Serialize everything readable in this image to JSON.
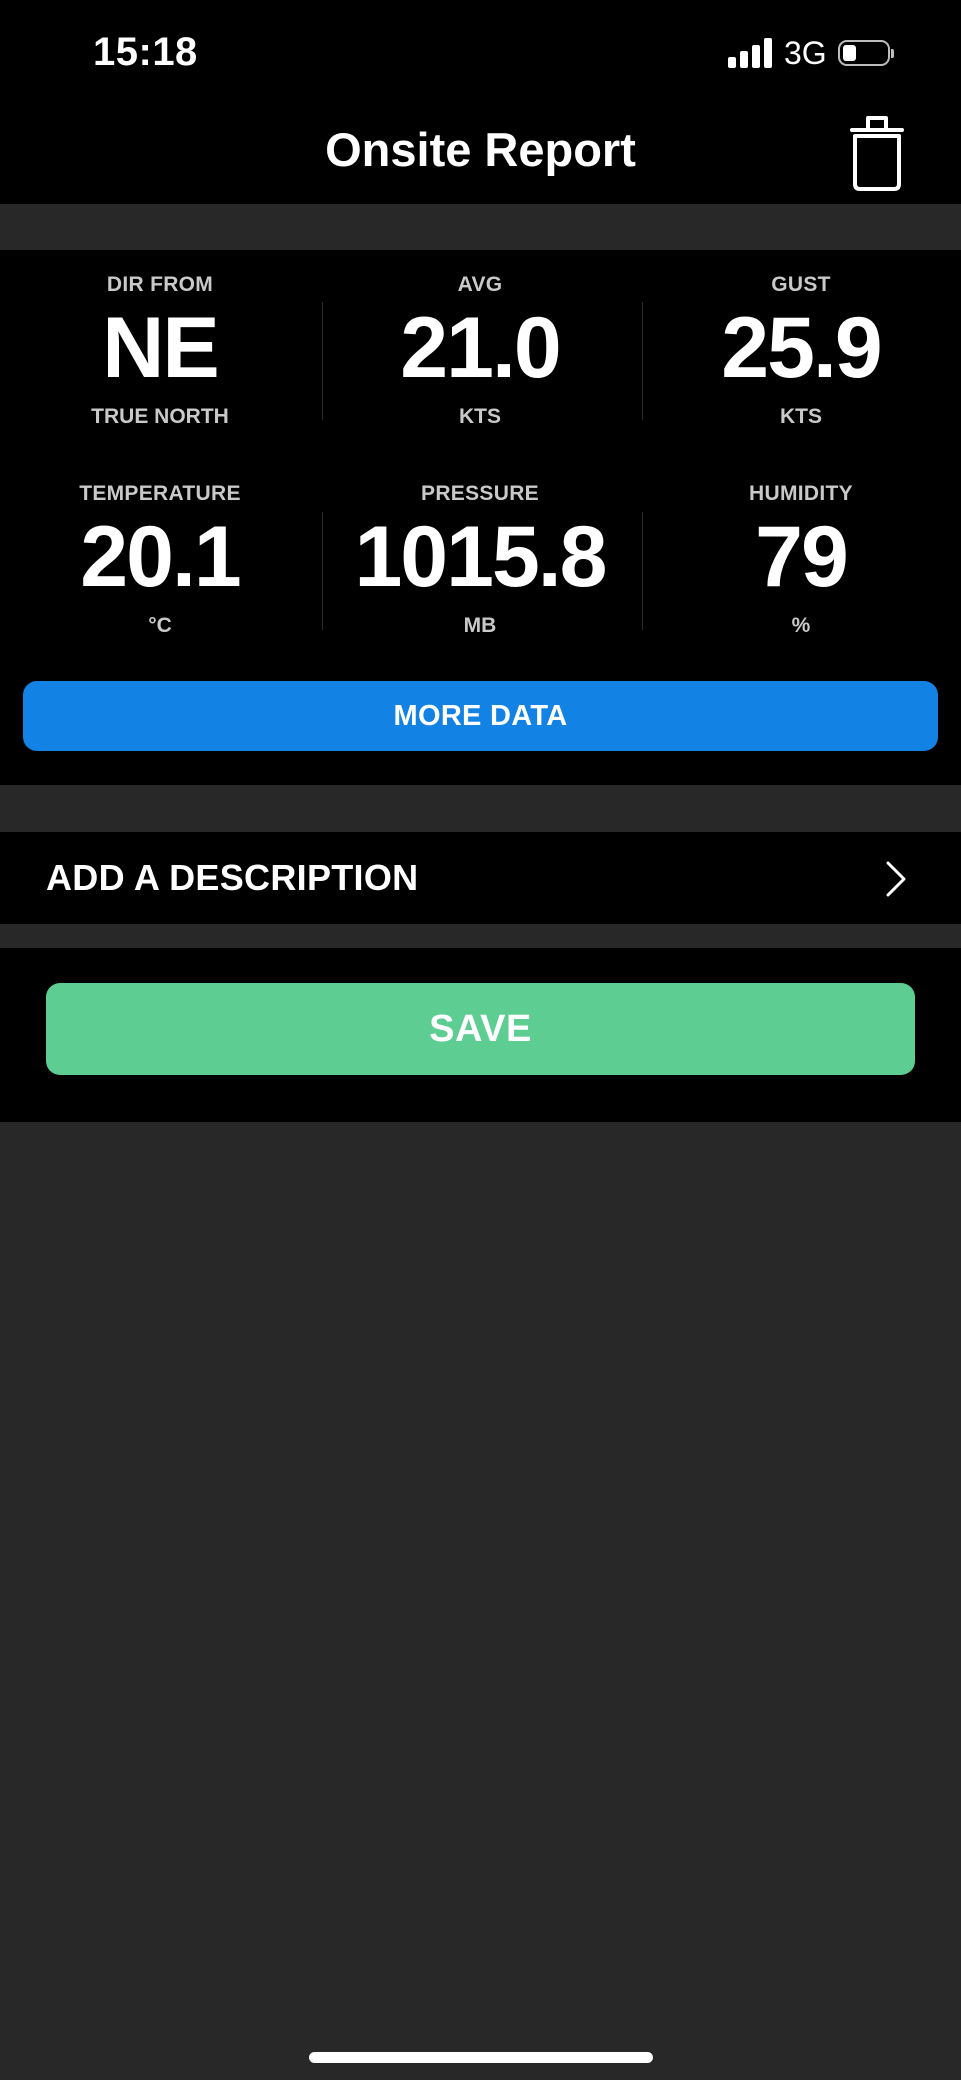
{
  "status_bar": {
    "time": "15:18",
    "network": "3G",
    "signal_icon": "cellular-signal-icon",
    "battery_icon": "battery-icon",
    "battery_level": 0.2
  },
  "header": {
    "title": "Onsite Report",
    "delete_icon": "trash-icon"
  },
  "metrics": [
    {
      "label": "DIR FROM",
      "value": "NE",
      "unit": "TRUE NORTH"
    },
    {
      "label": "AVG",
      "value": "21.0",
      "unit": "KTS"
    },
    {
      "label": "GUST",
      "value": "25.9",
      "unit": "KTS"
    },
    {
      "label": "TEMPERATURE",
      "value": "20.1",
      "unit": "°C"
    },
    {
      "label": "PRESSURE",
      "value": "1015.8",
      "unit": "MB"
    },
    {
      "label": "HUMIDITY",
      "value": "79",
      "unit": "%"
    }
  ],
  "more_data_button": {
    "label": "MORE DATA"
  },
  "description_row": {
    "label": "ADD A DESCRIPTION",
    "chevron_icon": "chevron-right-icon"
  },
  "save_button": {
    "label": "SAVE"
  },
  "colors": {
    "accent_blue": "#1282e4",
    "save_green": "#5dcd92",
    "background": "#282828",
    "panel": "#000000"
  }
}
